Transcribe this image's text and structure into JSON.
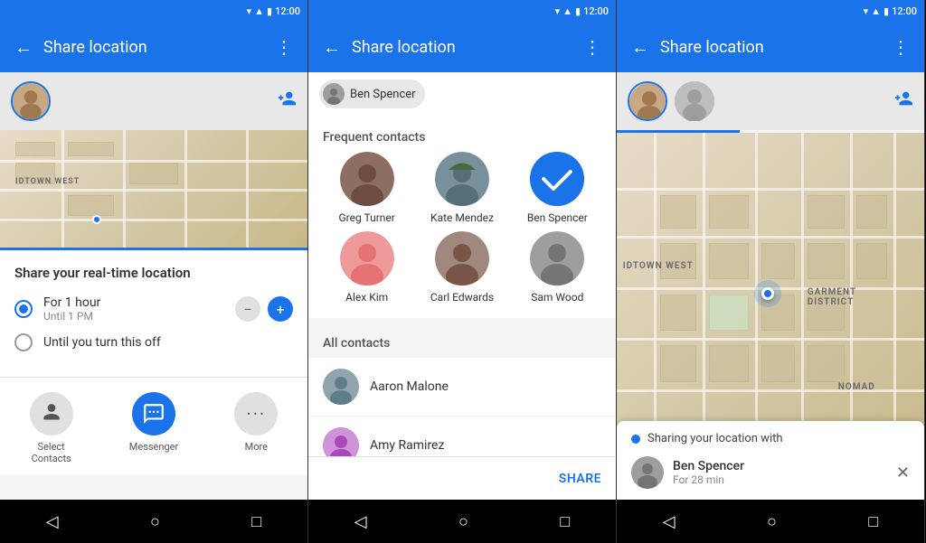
{
  "statusBar": {
    "time": "12:00",
    "wifiIcon": "▾",
    "signalIcon": "▲",
    "batteryIcon": "▮"
  },
  "panels": {
    "panel1": {
      "title": "Share location",
      "backIcon": "←",
      "menuIcon": "⋮",
      "addPersonIcon": "👤+",
      "shareTitle": "Share your real-time location",
      "options": [
        {
          "label": "For 1 hour",
          "sublabel": "Until 1 PM",
          "selected": true
        },
        {
          "label": "Until you turn this off",
          "selected": false
        }
      ],
      "apps": [
        {
          "label": "Select\nContacts",
          "icon": "👤"
        },
        {
          "label": "Messenger",
          "icon": "✉"
        },
        {
          "label": "More",
          "icon": "•••"
        }
      ],
      "nav": [
        "◁",
        "○",
        "□"
      ]
    },
    "panel2": {
      "title": "Share location",
      "backIcon": "←",
      "menuIcon": "⋮",
      "selectedContact": "Ben Spencer",
      "frequentHeader": "Frequent contacts",
      "frequentContacts": [
        {
          "name": "Greg Turner",
          "selected": false
        },
        {
          "name": "Kate Mendez",
          "selected": false
        },
        {
          "name": "Ben Spencer",
          "selected": true
        },
        {
          "name": "Alex Kim",
          "selected": false
        },
        {
          "name": "Carl Edwards",
          "selected": false
        },
        {
          "name": "Sam Wood",
          "selected": false
        }
      ],
      "allHeader": "All contacts",
      "allContacts": [
        {
          "name": "Aaron Malone"
        },
        {
          "name": "Amy Ramirez"
        }
      ],
      "shareButton": "SHARE",
      "nav": [
        "◁",
        "○",
        "□"
      ]
    },
    "panel3": {
      "title": "Share location",
      "backIcon": "←",
      "menuIcon": "⋮",
      "addPersonIcon": "👤+",
      "sharingCard": {
        "header": "Sharing your location with",
        "person": {
          "name": "Ben Spencer",
          "sub": "For 28 min"
        },
        "closeIcon": "✕"
      },
      "mapLabels": [
        {
          "text": "IDTOWN WEST",
          "top": "30%",
          "left": "5%"
        },
        {
          "text": "GARMENT\nDISTRICT",
          "top": "45%",
          "left": "55%"
        },
        {
          "text": "NOMAD",
          "top": "72%",
          "left": "75%"
        }
      ],
      "nav": [
        "◁",
        "○",
        "□"
      ]
    }
  }
}
